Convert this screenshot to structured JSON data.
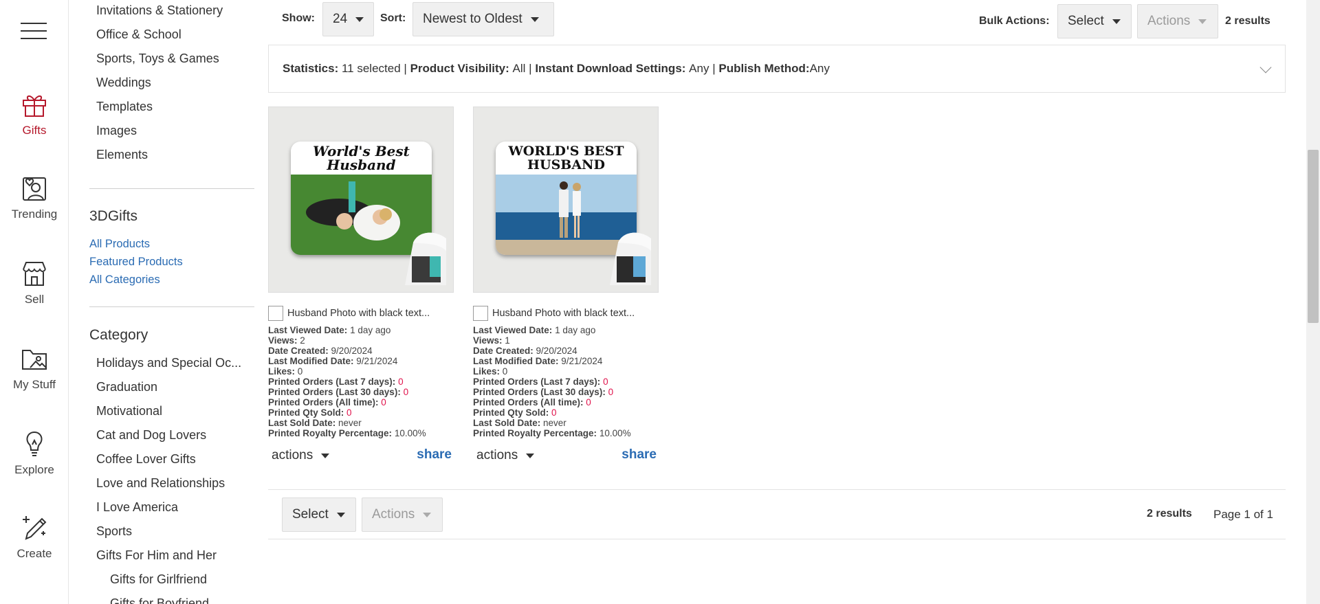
{
  "rail": {
    "items": [
      {
        "label": "Gifts",
        "icon": "gift-icon"
      },
      {
        "label": "Trending",
        "icon": "trending-icon"
      },
      {
        "label": "Sell",
        "icon": "store-icon"
      },
      {
        "label": "My Stuff",
        "icon": "folder-icon"
      },
      {
        "label": "Explore",
        "icon": "lightbulb-icon"
      },
      {
        "label": "Create",
        "icon": "create-icon"
      }
    ],
    "active_color": "#b5182b"
  },
  "sidebar": {
    "top_links": [
      "Invitations & Stationery",
      "Office & School",
      "Sports, Toys & Games",
      "Weddings",
      "Templates",
      "Images",
      "Elements"
    ],
    "store_title": "3DGifts",
    "store_links": [
      "All Products",
      "Featured Products",
      "All Categories"
    ],
    "category_title": "Category",
    "categories": [
      "Holidays and Special Oc...",
      "Graduation",
      "Motivational",
      "Cat and Dog Lovers",
      "Coffee Lover Gifts",
      "Love and Relationships",
      "I Love America",
      "Sports",
      "Gifts For Him and Her"
    ],
    "subcategories": [
      "Gifts for Girlfriend",
      "Gifts for Boyfriend"
    ]
  },
  "toolbar": {
    "show_label": "Show:",
    "show_value": "24",
    "sort_label": "Sort:",
    "sort_value": "Newest to Oldest",
    "bulk_label": "Bulk Actions:",
    "select_label": "Select",
    "actions_label": "Actions",
    "results": "2 results"
  },
  "stats": {
    "statistics_label": "Statistics:",
    "statistics_value": "11 selected",
    "visibility_label": "Product Visibility:",
    "visibility_value": "All",
    "download_label": "Instant Download Settings:",
    "download_value": "Any",
    "publish_label": "Publish Method:",
    "publish_value": "Any",
    "separator": "|"
  },
  "products": [
    {
      "mat_text": "World's Best Husband",
      "title": "Husband Photo with black text...",
      "fields": [
        {
          "k": "Last Viewed Date:",
          "v": "1 day ago"
        },
        {
          "k": "Views:",
          "v": "2"
        },
        {
          "k": "Date Created:",
          "v": "9/20/2024"
        },
        {
          "k": "Last Modified Date:",
          "v": "9/21/2024"
        },
        {
          "k": "Likes:",
          "v": "0"
        },
        {
          "k": "Printed Orders (Last 7 days):",
          "v": "0",
          "red": true
        },
        {
          "k": "Printed Orders (Last 30 days):",
          "v": "0",
          "red": true
        },
        {
          "k": "Printed Orders (All time):",
          "v": "0",
          "red": true
        },
        {
          "k": "Printed Qty Sold:",
          "v": "0",
          "red": true
        },
        {
          "k": "Last Sold Date:",
          "v": "never"
        },
        {
          "k": "Printed Royalty Percentage:",
          "v": "10.00%"
        }
      ],
      "actions_label": "actions",
      "share_label": "share"
    },
    {
      "mat_text": "WORLD'S BEST HUSBAND",
      "title": "Husband Photo with black text...",
      "fields": [
        {
          "k": "Last Viewed Date:",
          "v": "1 day ago"
        },
        {
          "k": "Views:",
          "v": "1"
        },
        {
          "k": "Date Created:",
          "v": "9/20/2024"
        },
        {
          "k": "Last Modified Date:",
          "v": "9/21/2024"
        },
        {
          "k": "Likes:",
          "v": "0"
        },
        {
          "k": "Printed Orders (Last 7 days):",
          "v": "0",
          "red": true
        },
        {
          "k": "Printed Orders (Last 30 days):",
          "v": "0",
          "red": true
        },
        {
          "k": "Printed Orders (All time):",
          "v": "0",
          "red": true
        },
        {
          "k": "Printed Qty Sold:",
          "v": "0",
          "red": true
        },
        {
          "k": "Last Sold Date:",
          "v": "never"
        },
        {
          "k": "Printed Royalty Percentage:",
          "v": "10.00%"
        }
      ],
      "actions_label": "actions",
      "share_label": "share"
    }
  ],
  "footer": {
    "select_label": "Select",
    "actions_label": "Actions",
    "results": "2 results",
    "page": "Page 1 of 1"
  },
  "colors": {
    "link_blue": "#2a6bb3",
    "alert_red": "#e0134c"
  }
}
